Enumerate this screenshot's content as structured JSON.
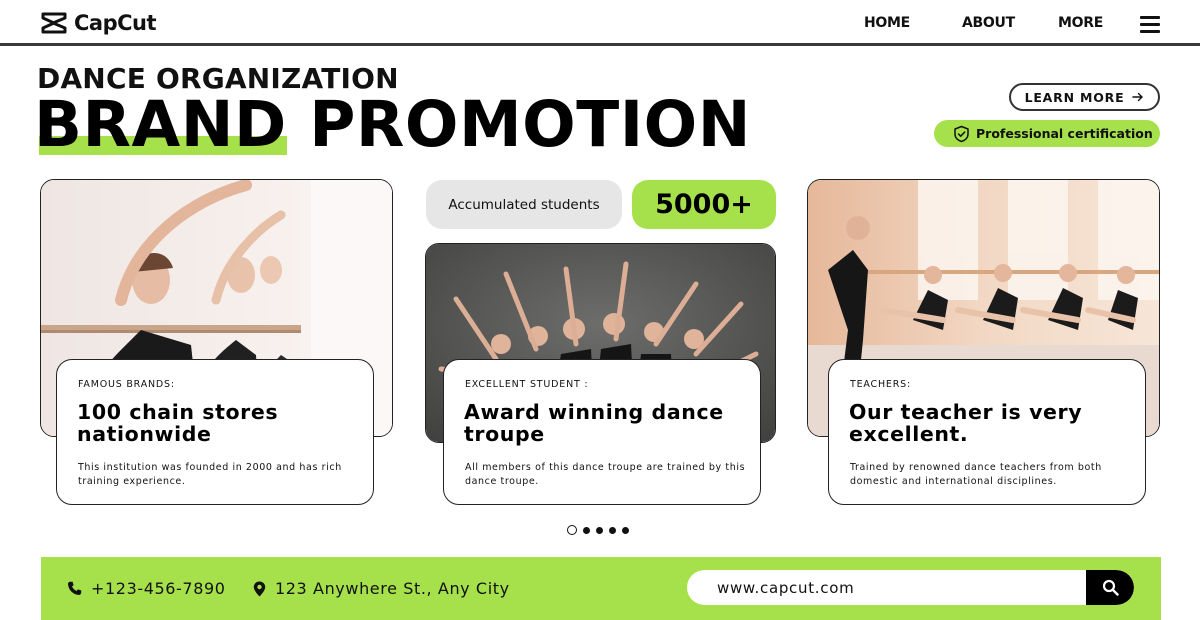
{
  "header": {
    "brand": "CapCut",
    "nav": {
      "home": "HOME",
      "about": "ABOUT",
      "more": "MORE"
    },
    "logo_icon": "capcut-logo-icon",
    "menu_icon": "hamburger-menu-icon"
  },
  "hero": {
    "subtitle": "DANCE ORGANIZATION",
    "title": "BRAND PROMOTION",
    "learn_more": "LEARN MORE",
    "learn_more_icon": "arrow-right-icon",
    "certification": "Professional certification",
    "certification_icon": "shield-check-icon"
  },
  "stats": {
    "label": "Accumulated students",
    "value": "5000+"
  },
  "cards": [
    {
      "tag": "FAMOUS BRANDS:",
      "heading": "100 chain stores nationwide",
      "description": "This institution was founded in 2000 and has rich training experience."
    },
    {
      "tag": "EXCELLENT STUDENT :",
      "heading": "Award winning dance troupe",
      "description": "All members of this dance troupe are trained by this dance troupe."
    },
    {
      "tag": "TEACHERS:",
      "heading": "Our teacher is very excellent.",
      "description": "Trained by renowned dance teachers from both domestic and international disciplines."
    }
  ],
  "pagination": {
    "total": 5,
    "active": 1
  },
  "footer": {
    "phone": "+123-456-7890",
    "address": "123 Anywhere St., Any City",
    "website": "www.capcut.com",
    "phone_icon": "phone-icon",
    "address_icon": "location-pin-icon",
    "search_icon": "search-icon"
  },
  "colors": {
    "accent": "#a6e14b",
    "text": "#111111",
    "stat_bg": "#e6e6e6"
  }
}
